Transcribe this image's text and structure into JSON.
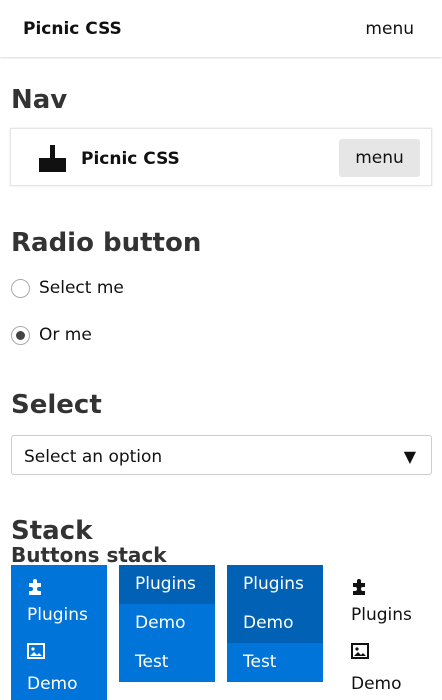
{
  "topbar": {
    "brand": "Picnic CSS",
    "menu": "menu"
  },
  "sections": {
    "nav": "Nav",
    "radio": "Radio button",
    "select": "Select",
    "stack": "Stack"
  },
  "nav_demo": {
    "brand": "Picnic CSS",
    "menu_button": "menu"
  },
  "radio": {
    "options": [
      {
        "label": "Select me",
        "checked": false
      },
      {
        "label": "Or me",
        "checked": true
      }
    ]
  },
  "select": {
    "value": "Select an option",
    "arrow": "▼"
  },
  "stack": {
    "subtitle": "Buttons stack",
    "col1": {
      "items": [
        "Plugins",
        "Demo"
      ]
    },
    "col2": {
      "items": [
        "Plugins",
        "Demo",
        "Test"
      ]
    },
    "col3": {
      "items": [
        "Plugins",
        "Demo",
        "Test"
      ]
    },
    "col4": {
      "items": [
        "Plugins",
        "Demo"
      ]
    }
  },
  "colors": {
    "primary": "#0074d9",
    "primary_dark": "#0061b5"
  }
}
